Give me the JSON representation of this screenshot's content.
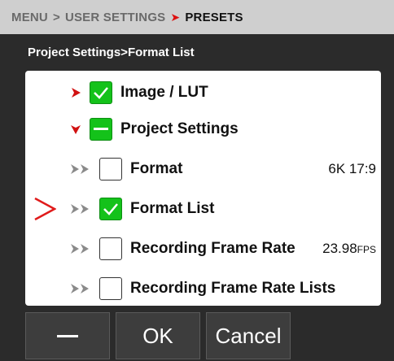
{
  "breadcrumb": {
    "menu": "MENU",
    "sep": ">",
    "user_settings": "USER SETTINGS",
    "red_sep": "➤",
    "presets": "PRESETS"
  },
  "subtitle": "Project Settings>Format List",
  "list": {
    "items": [
      {
        "label": "Image / LUT",
        "state": "checked",
        "indicator": "red-chevron-right",
        "value": ""
      },
      {
        "label": "Project Settings",
        "state": "partial",
        "indicator": "red-chevron-down",
        "value": ""
      },
      {
        "label": "Format",
        "state": "unchecked",
        "indicator": "grey-double-chevron",
        "value": "6K 17:9"
      },
      {
        "label": "Format List",
        "state": "checked",
        "indicator": "grey-double-chevron",
        "value": "",
        "selected": true
      },
      {
        "label": "Recording Frame Rate",
        "state": "unchecked",
        "indicator": "grey-double-chevron",
        "value_main": "23.98",
        "value_unit": "FPS"
      },
      {
        "label": "Recording Frame Rate Lists",
        "state": "unchecked",
        "indicator": "grey-double-chevron",
        "value": ""
      }
    ]
  },
  "buttons": {
    "ok": "OK",
    "cancel": "Cancel"
  },
  "colors": {
    "green": "#14c21a",
    "red": "#d11111",
    "panel": "#2b2b2b",
    "header": "#cfcfcf"
  }
}
